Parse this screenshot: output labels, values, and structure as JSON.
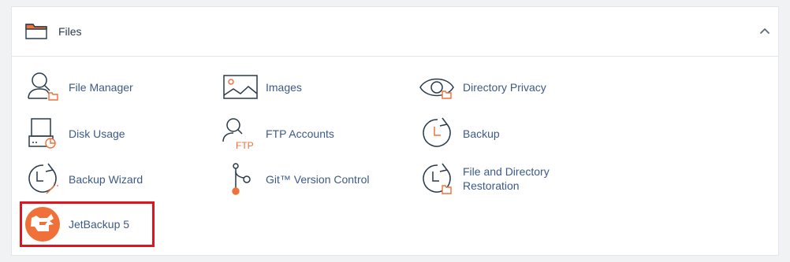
{
  "section": {
    "title": "Files",
    "folder_icon": "folder-icon",
    "collapse_icon": "chevron-up-icon"
  },
  "items": [
    {
      "label": "File Manager",
      "icon": "file-manager-icon"
    },
    {
      "label": "Images",
      "icon": "images-icon"
    },
    {
      "label": "Directory Privacy",
      "icon": "directory-privacy-icon"
    },
    {
      "label": "Disk Usage",
      "icon": "disk-usage-icon"
    },
    {
      "label": "FTP Accounts",
      "icon": "ftp-accounts-icon"
    },
    {
      "label": "Backup",
      "icon": "backup-icon"
    },
    {
      "label": "Backup Wizard",
      "icon": "backup-wizard-icon"
    },
    {
      "label": "Git™ Version Control",
      "icon": "git-icon"
    },
    {
      "label": "File and Directory",
      "label_line2": "Restoration",
      "icon": "file-restoration-icon"
    },
    {
      "label": "JetBackup 5",
      "icon": "jetbackup-icon"
    }
  ],
  "colors": {
    "accent": "#f0703a",
    "link": "#3c5a86",
    "icon_stroke": "#293a4a",
    "highlight": "#e0141e"
  }
}
